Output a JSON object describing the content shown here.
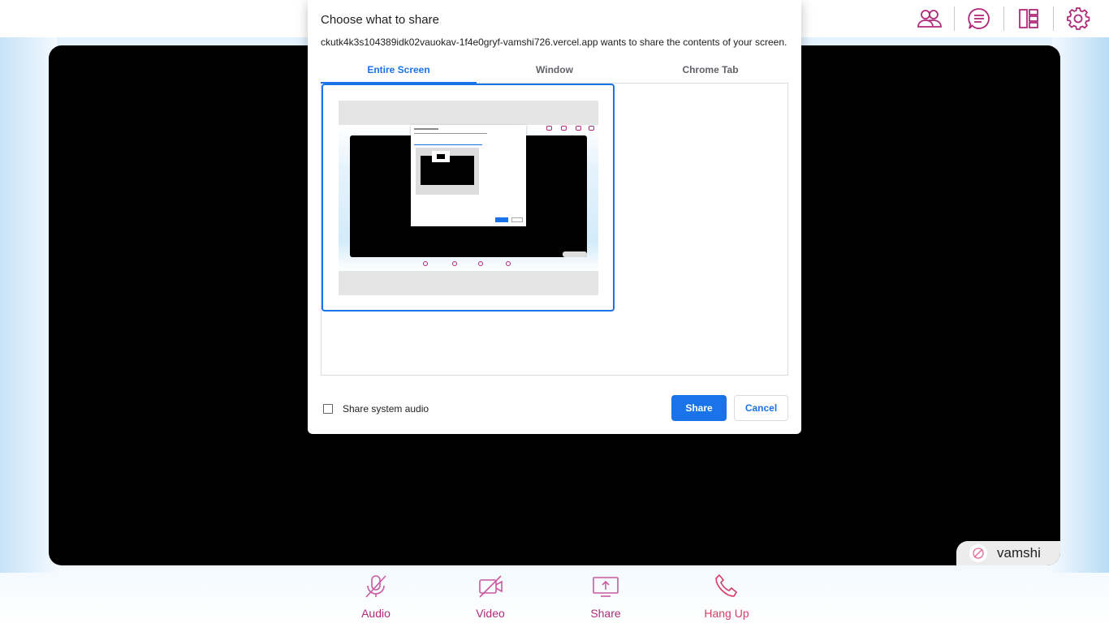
{
  "dialog": {
    "title": "Choose what to share",
    "subtitle": "ckutk4k3s104389idk02vauokav-1f4e0gryf-vamshi726.vercel.app wants to share the contents of your screen.",
    "tabs": [
      {
        "label": "Entire Screen",
        "active": true
      },
      {
        "label": "Window",
        "active": false
      },
      {
        "label": "Chrome Tab",
        "active": false
      }
    ],
    "audio_checkbox_label": "Share system audio",
    "audio_checked": false,
    "share_label": "Share",
    "cancel_label": "Cancel"
  },
  "top_toolbar": {
    "icons": [
      "participants-icon",
      "chat-icon",
      "layout-icon",
      "settings-icon"
    ]
  },
  "stage": {
    "participant_name": "vamshi"
  },
  "controls": [
    {
      "label": "Audio",
      "icon": "mic-off-icon"
    },
    {
      "label": "Video",
      "icon": "video-off-icon"
    },
    {
      "label": "Share",
      "icon": "screen-share-icon"
    },
    {
      "label": "Hang Up",
      "icon": "phone-icon"
    }
  ],
  "colors": {
    "accent": "#1a73e8",
    "brand": "#b0287a",
    "hangup": "#d63c64"
  }
}
